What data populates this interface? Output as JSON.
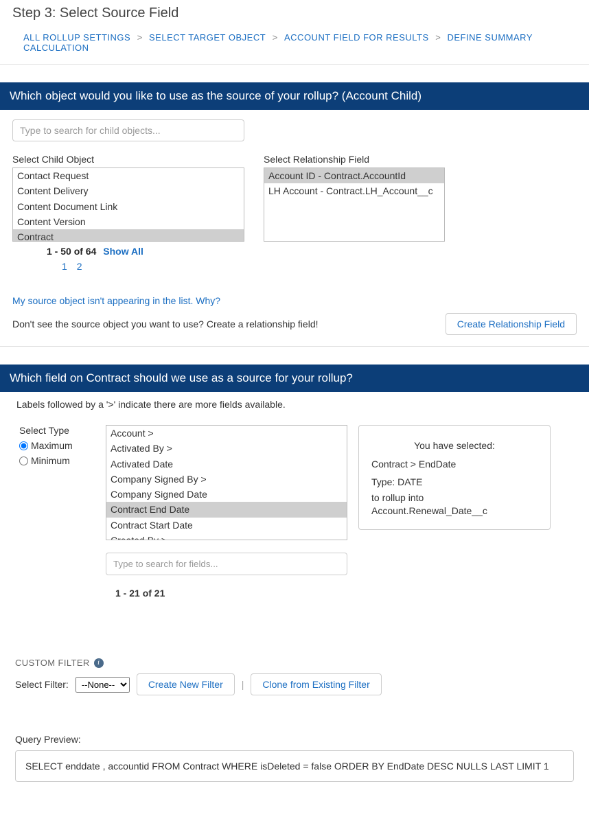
{
  "page_title": "Step 3: Select Source Field",
  "breadcrumb": {
    "items": [
      "ALL ROLLUP SETTINGS",
      "SELECT TARGET OBJECT",
      "ACCOUNT FIELD FOR RESULTS",
      "DEFINE SUMMARY CALCULATION"
    ]
  },
  "section1": {
    "header": "Which object would you like to use as the source of your rollup? (Account Child)",
    "search_placeholder": "Type to search for child objects...",
    "child_label": "Select Child Object",
    "child_items": [
      {
        "label": "Contact Request",
        "selected": false
      },
      {
        "label": "Content Delivery",
        "selected": false
      },
      {
        "label": "Content Document Link",
        "selected": false
      },
      {
        "label": "Content Version",
        "selected": false
      },
      {
        "label": "Contract",
        "selected": true
      }
    ],
    "rel_label": "Select Relationship Field",
    "rel_items": [
      {
        "label": "Account ID - Contract.AccountId",
        "selected": true
      },
      {
        "label": "LH Account - Contract.LH_Account__c",
        "selected": false
      }
    ],
    "pager_counts": "1 - 50 of 64",
    "pager_showall": "Show All",
    "pager_pages": [
      "1",
      "2"
    ],
    "help_link": "My source object isn't appearing in the list. Why?",
    "help_text": "Don't see the source object you want to use? Create a relationship field!",
    "create_rel_btn": "Create Relationship Field"
  },
  "section2": {
    "header": "Which field on Contract should we use as a source for your rollup?",
    "hint": "Labels followed by a '>' indicate there are more fields available.",
    "type_label": "Select Type",
    "type_options": [
      {
        "label": "Maximum",
        "checked": true
      },
      {
        "label": "Minimum",
        "checked": false
      }
    ],
    "field_items": [
      {
        "label": "Account >",
        "selected": false
      },
      {
        "label": "Activated By >",
        "selected": false
      },
      {
        "label": "Activated Date",
        "selected": false
      },
      {
        "label": "Company Signed By >",
        "selected": false
      },
      {
        "label": "Company Signed Date",
        "selected": false
      },
      {
        "label": "Contract End Date",
        "selected": true
      },
      {
        "label": "Contract Start Date",
        "selected": false
      },
      {
        "label": "Created By >",
        "selected": false
      }
    ],
    "field_search_placeholder": "Type to search for fields...",
    "field_count": "1 - 21 of 21",
    "summary": {
      "title": "You have selected:",
      "path": "Contract > EndDate",
      "type": "Type: DATE",
      "rollup": "to rollup into",
      "target": "Account.Renewal_Date__c"
    }
  },
  "custom_filter": {
    "title": "CUSTOM FILTER",
    "label": "Select Filter:",
    "selected": "--None--",
    "create_btn": "Create New Filter",
    "clone_btn": "Clone from Existing Filter"
  },
  "query": {
    "label": "Query Preview:",
    "text": "SELECT enddate , accountid FROM Contract WHERE isDeleted = false ORDER BY EndDate DESC NULLS LAST LIMIT 1"
  }
}
